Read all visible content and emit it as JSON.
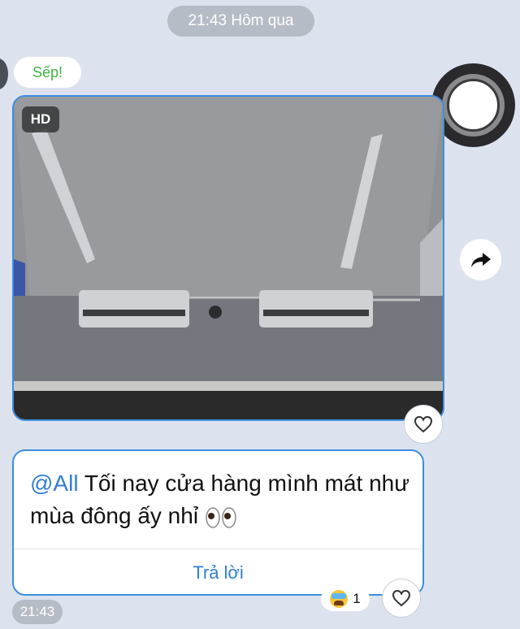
{
  "chat": {
    "date_header": "21:43 Hôm qua",
    "sender_name": "Sếp!",
    "photo": {
      "badge": "HD",
      "description_icon": "air-conditioner-photo"
    },
    "message": {
      "mention": "@All",
      "text": " Tối nay cửa hàng mình mát như mùa đông ấy nhỉ",
      "emoji": "eyes-icon",
      "reply_label": "Trả lời"
    },
    "reaction": {
      "emoji": "crying-face-icon",
      "count": "1"
    },
    "message_time": "21:43"
  },
  "colors": {
    "background": "#dde3ee",
    "accent": "#2f7fd4",
    "sender": "#3fb243"
  }
}
